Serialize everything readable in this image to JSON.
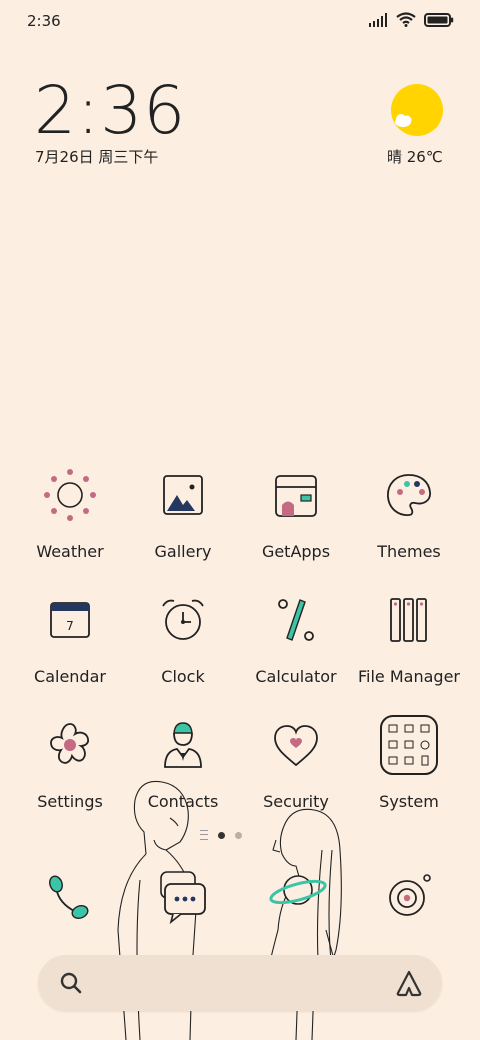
{
  "status_bar": {
    "time": "2:36"
  },
  "widget": {
    "time": "2:36",
    "date": "7月26日 周三下午",
    "weather": "晴 26℃"
  },
  "apps": [
    {
      "label": "Weather",
      "icon": "sun-icon"
    },
    {
      "label": "Gallery",
      "icon": "image-icon"
    },
    {
      "label": "GetApps",
      "icon": "store-icon"
    },
    {
      "label": "Themes",
      "icon": "palette-icon"
    },
    {
      "label": "Calendar",
      "icon": "calendar-icon",
      "day": "7"
    },
    {
      "label": "Clock",
      "icon": "alarm-clock-icon"
    },
    {
      "label": "Calculator",
      "icon": "percent-icon"
    },
    {
      "label": "File Manager",
      "icon": "folders-icon"
    },
    {
      "label": "Settings",
      "icon": "flower-gear-icon"
    },
    {
      "label": "Contacts",
      "icon": "person-icon"
    },
    {
      "label": "Security",
      "icon": "heart-icon"
    },
    {
      "label": "System",
      "icon": "app-folder-icon"
    }
  ],
  "dock": [
    {
      "icon": "phone-icon"
    },
    {
      "icon": "messages-icon"
    },
    {
      "icon": "camera-icon"
    }
  ],
  "colors": {
    "background": "#fcefe2",
    "accent_teal": "#3cc4a6",
    "accent_pink": "#c46a82",
    "accent_navy": "#23375f"
  }
}
